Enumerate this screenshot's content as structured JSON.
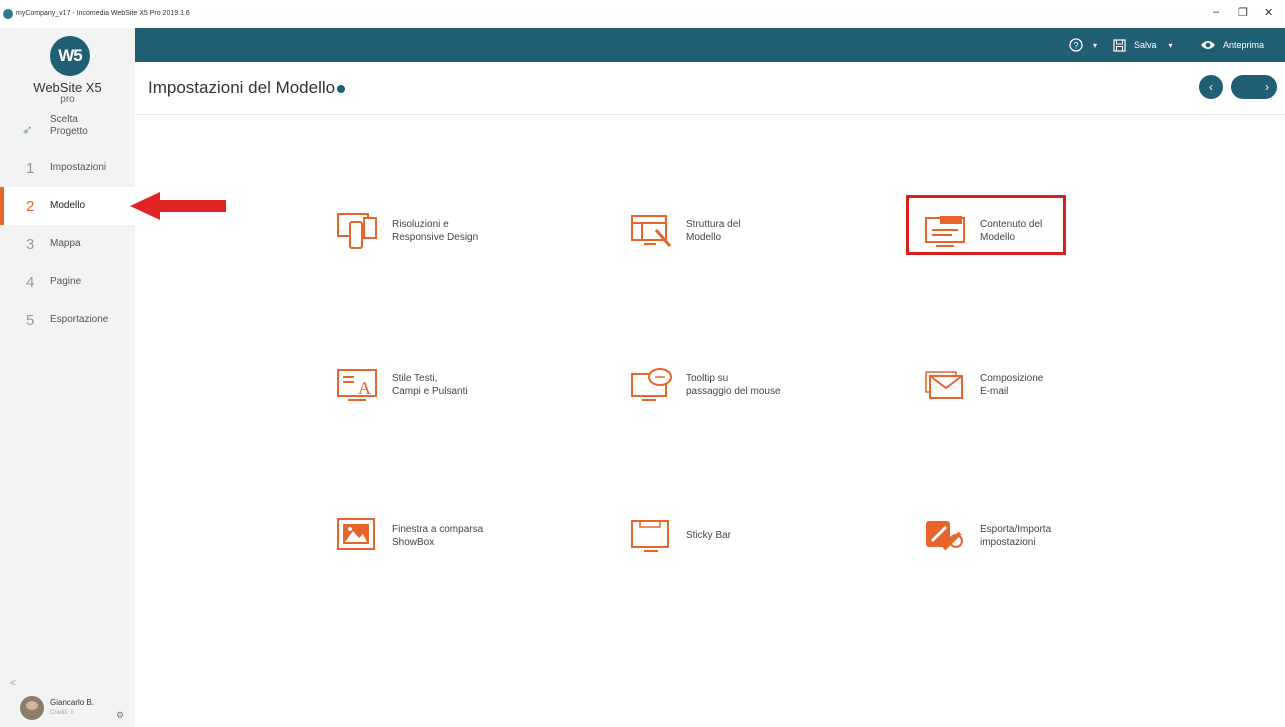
{
  "window": {
    "title": "myCompany_v17 - Incomedia WebSite X5 Pro 2019.1.6",
    "minimize": "–",
    "restore": "❐",
    "close": "✕"
  },
  "logo": {
    "mark": "W5",
    "name": "WebSite X5",
    "edition": "pro"
  },
  "sidebar": {
    "items": [
      {
        "num": "",
        "label": "Scelta\nProgetto",
        "icon": "rocket-icon"
      },
      {
        "num": "1",
        "label": "Impostazioni"
      },
      {
        "num": "2",
        "label": "Modello",
        "active": true
      },
      {
        "num": "3",
        "label": "Mappa"
      },
      {
        "num": "4",
        "label": "Pagine"
      },
      {
        "num": "5",
        "label": "Esportazione"
      }
    ],
    "collapse": "<",
    "user": {
      "name": "Giancarlo B.",
      "sub": "Crediti: 0"
    }
  },
  "topbar": {
    "help": "?",
    "save_label": "Salva",
    "preview_label": "Anteprima"
  },
  "header": {
    "title": "Impostazioni del Modello",
    "prev": "‹",
    "next": "›"
  },
  "tiles": [
    {
      "label": "Risoluzioni e\nResponsive Design",
      "icon": "responsive-icon"
    },
    {
      "label": "Struttura del\nModello",
      "icon": "structure-icon"
    },
    {
      "label": "Contenuto del\nModello",
      "icon": "content-icon",
      "highlighted": true
    },
    {
      "label": "Stile Testi,\nCampi e Pulsanti",
      "icon": "text-style-icon"
    },
    {
      "label": "Tooltip su\npassaggio del mouse",
      "icon": "tooltip-icon"
    },
    {
      "label": "Composizione\nE-mail",
      "icon": "email-icon"
    },
    {
      "label": "Finestra a comparsa\nShowBox",
      "icon": "showbox-icon"
    },
    {
      "label": "Sticky Bar",
      "icon": "sticky-bar-icon"
    },
    {
      "label": "Esporta/Importa\nimpostazioni",
      "icon": "export-import-icon"
    }
  ],
  "colors": {
    "accent": "#e8642a",
    "brand": "#1f5e73",
    "annotation": "#d61f1f"
  }
}
